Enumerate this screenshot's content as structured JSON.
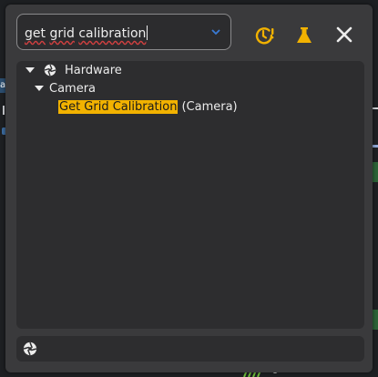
{
  "search": {
    "value": "get grid calibration",
    "words": [
      "get",
      "grid",
      "calibration"
    ]
  },
  "toolbar": {
    "history_icon": "clock-alert-icon",
    "filter_icon": "flask-icon",
    "close_icon": "close-icon"
  },
  "tree": {
    "root": {
      "label": "Hardware",
      "icon": "aperture-icon"
    },
    "child": {
      "label": "Camera"
    },
    "result": {
      "match": "Get Grid Calibration",
      "suffix": "(Camera)"
    }
  },
  "background": {
    "left_tag": "a)"
  },
  "colors": {
    "accent": "#f2b200",
    "dialog": "#3a3a3c",
    "panel": "#2d2d2f",
    "dropdown": "#3a7bd5"
  }
}
